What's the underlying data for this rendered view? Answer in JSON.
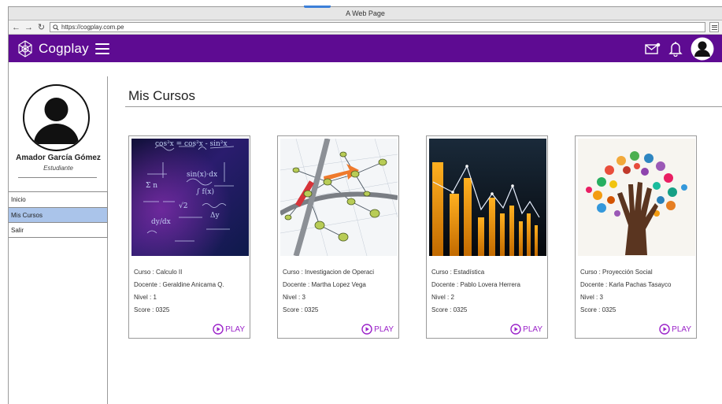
{
  "window": {
    "title": "A Web Page"
  },
  "browser": {
    "url": "https://cogplay.com.pe"
  },
  "app": {
    "brand": "Cogplay",
    "colors": {
      "primary": "#5e0b92",
      "accent": "#9b23c9",
      "active_nav": "#aac4ea"
    },
    "icons": [
      "mail-notification-icon",
      "bell-icon",
      "user-avatar-icon"
    ]
  },
  "profile": {
    "name": "Amador García Gómez",
    "role": "Estudiante"
  },
  "sidebar": {
    "items": [
      {
        "label": "Inicio",
        "active": false
      },
      {
        "label": "Mis Cursos",
        "active": true
      },
      {
        "label": "Salir",
        "active": false
      }
    ]
  },
  "main": {
    "title": "Mis Cursos"
  },
  "courses": [
    {
      "course": "Curso : Calculo II",
      "teacher": "Docente : Geraldine Anicama Q.",
      "level": "Nivel : 1",
      "score": "Score : 0325",
      "play": "PLAY"
    },
    {
      "course": "Curso : Investigacion de Operaci",
      "teacher": "Docente : Martha Lopez Vega",
      "level": "Nivel : 3",
      "score": "Score : 0325",
      "play": "PLAY"
    },
    {
      "course": "Curso : Estadística",
      "teacher": "Docente : Pablo Lovera Herrera",
      "level": "Nivel : 2",
      "score": "Score : 0325",
      "play": "PLAY"
    },
    {
      "course": "Curso : Proyección Social",
      "teacher": "Docente : Karla Pachas Tasayco",
      "level": "Nivel : 3",
      "score": "Score : 0325",
      "play": "PLAY"
    }
  ]
}
